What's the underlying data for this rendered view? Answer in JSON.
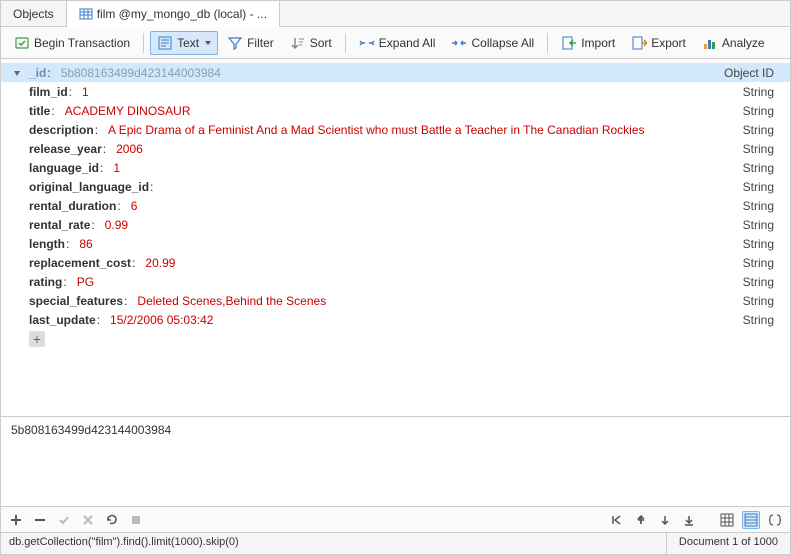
{
  "tabs": {
    "objects": "Objects",
    "active": "film @my_mongo_db (local) - ..."
  },
  "toolbar": {
    "beginTx": "Begin Transaction",
    "text": "Text",
    "filter": "Filter",
    "sort": "Sort",
    "expandAll": "Expand All",
    "collapseAll": "Collapse All",
    "import": "Import",
    "export": "Export",
    "analyze": "Analyze"
  },
  "fields": [
    {
      "key": "_id",
      "value": "5b808163499d423144003984",
      "type": "Object ID",
      "selected": true,
      "oid": true
    },
    {
      "key": "film_id",
      "value": "1",
      "type": "String"
    },
    {
      "key": "title",
      "value": "ACADEMY DINOSAUR",
      "type": "String"
    },
    {
      "key": "description",
      "value": "A Epic Drama of a Feminist And a Mad Scientist who must Battle a Teacher in The Canadian Rockies",
      "type": "String"
    },
    {
      "key": "release_year",
      "value": "2006",
      "type": "String"
    },
    {
      "key": "language_id",
      "value": "1",
      "type": "String"
    },
    {
      "key": "original_language_id",
      "value": "",
      "type": "String"
    },
    {
      "key": "rental_duration",
      "value": "6",
      "type": "String"
    },
    {
      "key": "rental_rate",
      "value": "0.99",
      "type": "String"
    },
    {
      "key": "length",
      "value": "86",
      "type": "String"
    },
    {
      "key": "replacement_cost",
      "value": "20.99",
      "type": "String"
    },
    {
      "key": "rating",
      "value": "PG",
      "type": "String"
    },
    {
      "key": "special_features",
      "value": "Deleted Scenes,Behind the Scenes",
      "type": "String"
    },
    {
      "key": "last_update",
      "value": "15/2/2006 05:03:42",
      "type": "String"
    }
  ],
  "idPanel": "5b808163499d423144003984",
  "status": {
    "query": "db.getCollection(\"film\").find().limit(1000).skip(0)",
    "docCount": "Document 1 of 1000"
  }
}
